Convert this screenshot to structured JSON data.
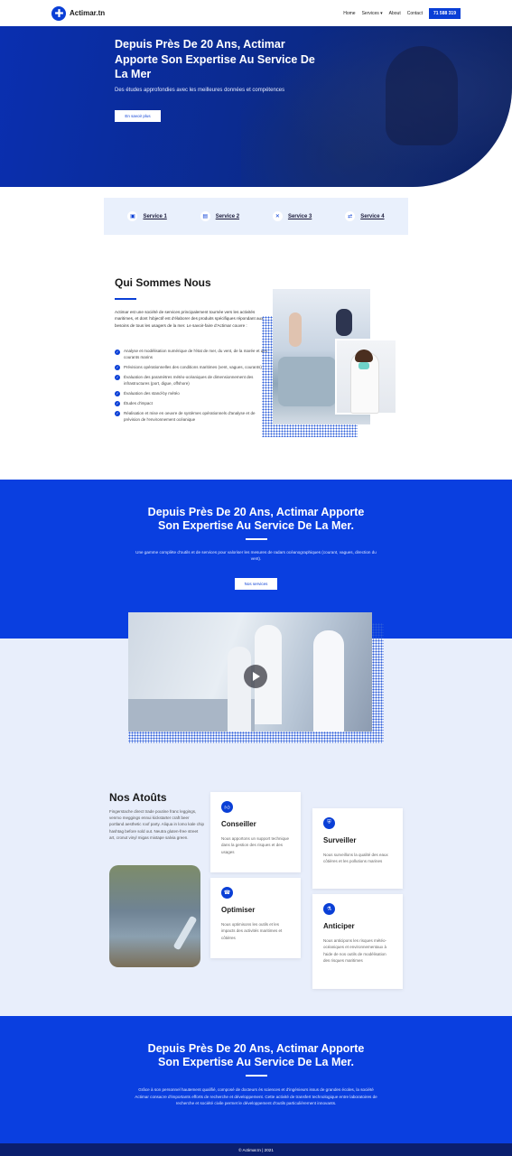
{
  "header": {
    "logo_text": "Actimar.tn",
    "nav": [
      "Home",
      "Services ▾",
      "About",
      "Contact"
    ],
    "phone": "71 588 319"
  },
  "hero": {
    "title": "Depuis Près De 20 Ans, Actimar Apporte Son Expertise Au Service De La Mer",
    "subtitle": "Des études approfondies avec les meilleures données et compétences",
    "button": "En savoir plus"
  },
  "services": [
    {
      "label": "Service 1",
      "icon": "hospital-icon"
    },
    {
      "label": "Service 2",
      "icon": "ambulance-icon"
    },
    {
      "label": "Service 3",
      "icon": "tools-icon"
    },
    {
      "label": "Service 4",
      "icon": "transfer-icon"
    }
  ],
  "about": {
    "title": "Qui Sommes Nous",
    "paragraph": "Actimar est une société de services principalement tournée vers les activités maritimes, et dont l'objectif est d'élaborer des produits spécifiques répondant aux besoins de tous les usagers de la mer. Le savoir-faire d'Actimar couvre :",
    "bullets": [
      "Analyse et modélisation numérique de l'état de mer, du vent, de la marée et des courants marins",
      "Prévisions opérationnelles des conditions maritimes (vent, vagues, courants)",
      "Évaluation des paramètres météo-océaniques de dimensionnement des infrastructures (port, digue, offshore)",
      "Évaluation des stand-by météo",
      "Études d'impact",
      "Réalisation et mise en oeuvre de systèmes opérationnels d'analyse et de prévision de l'environnement océanique"
    ]
  },
  "band1": {
    "title_line1": "Depuis Près De 20 Ans, Actimar Apporte",
    "title_line2": "Son Expertise Au Service De La Mer.",
    "text": "Une gamme complète d'outils et de services pour valoriser les mesures de radars océanographiques (courant, vagues, direction du vent).",
    "button": "Nos services"
  },
  "atouts": {
    "title": "Nos Atoûts",
    "text": "Fingerstache direct trade poutine franc leggings, venmo meggings ennui kickstarter craft beer portland aesthetic roof party. Aliqua in lomo kale chip hashtag before sold out. Neutra gluten-free street art, cronut vinyl migas mixtape salvia green.",
    "cards": [
      {
        "title": "Conseiller",
        "icon": "thumbs-up-icon",
        "text": "Nous apportons un support technique dans la gestion des risques et des usages"
      },
      {
        "title": "Optimiser",
        "icon": "phone-icon",
        "text": "Nous optimisons les outils et les impacts des activités maritimes et côtières"
      },
      {
        "title": "Surveiller",
        "icon": "shield-icon",
        "text": "Nous surveillons la qualité des eaux côtières et les pollutions marines"
      },
      {
        "title": "Anticiper",
        "icon": "flask-icon",
        "text": "Nous anticipons les risques météo-océaniques et environnementaux à l'aide de nos outils de modélisation des risques maritimes"
      }
    ]
  },
  "band2": {
    "title_line1": "Depuis Près De 20 Ans, Actimar Apporte",
    "title_line2": "Son Expertise Au Service De La Mer.",
    "text": "Grâce à son personnel hautement qualifié, composé de docteurs ès sciences et d'ingénieurs issus de grandes écoles, la société Actimar consacre d'importants efforts de recherche et développement. Cette activité de transfert technologique entre laboratoires de recherche et société civile permet le développement d'outils particulièrement innovants."
  },
  "footer": {
    "text": "© Actimar.tn | 2021"
  },
  "colors": {
    "accent": "#0a3fd6",
    "band": "#0a3fe0",
    "light": "#e8eefb",
    "footer": "#0b1f6e"
  }
}
